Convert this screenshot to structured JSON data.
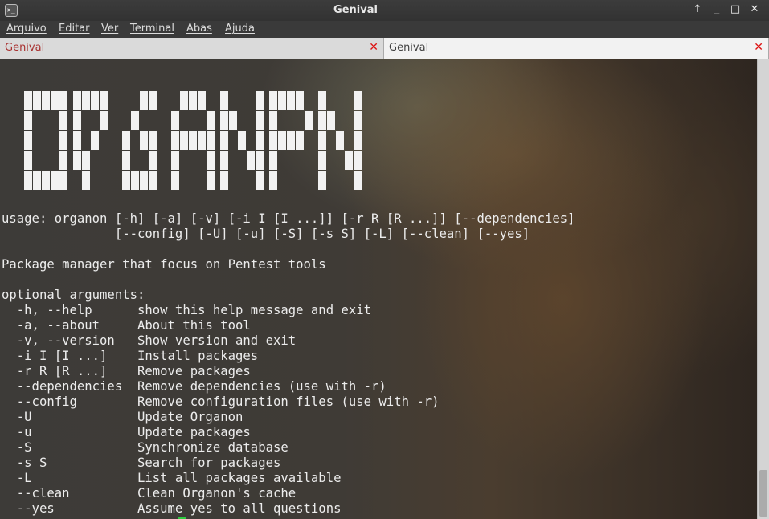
{
  "window": {
    "title": "Genival",
    "icon": "terminal-icon",
    "controls": [
      "maximize-up-icon",
      "minimize-icon",
      "restore-icon",
      "close-icon"
    ]
  },
  "menubar": {
    "items": [
      {
        "label": "Arquivo"
      },
      {
        "label": "Editar"
      },
      {
        "label": "Ver"
      },
      {
        "label": "Terminal"
      },
      {
        "label": "Abas"
      },
      {
        "label": "Ajuda"
      }
    ]
  },
  "tabs": [
    {
      "label": "Genival",
      "active": true
    },
    {
      "label": "Genival",
      "active": false
    }
  ],
  "terminal": {
    "banner_text": "ORGANON",
    "lines": [
      "usage: organon [-h] [-a] [-v] [-i I [I ...]] [-r R [R ...]] [--dependencies]",
      "               [--config] [-U] [-u] [-S] [-s S] [-L] [--clean] [--yes]",
      "",
      "Package manager that focus on Pentest tools",
      "",
      "optional arguments:",
      "  -h, --help      show this help message and exit",
      "  -a, --about     About this tool",
      "  -v, --version   Show version and exit",
      "  -i I [I ...]    Install packages",
      "  -r R [R ...]    Remove packages",
      "  --dependencies  Remove dependencies (use with -r)",
      "  --config        Remove configuration files (use with -r)",
      "  -U              Update Organon",
      "  -u              Update packages",
      "  -S              Synchronize database",
      "  -s S            Search for packages",
      "  -L              List all packages available",
      "  --clean         Clean Organon's cache",
      "  --yes           Assume yes to all questions"
    ]
  },
  "colors": {
    "tab_active_text": "#a8302f",
    "close": "#dd1111",
    "cursor": "#2ecc40"
  }
}
